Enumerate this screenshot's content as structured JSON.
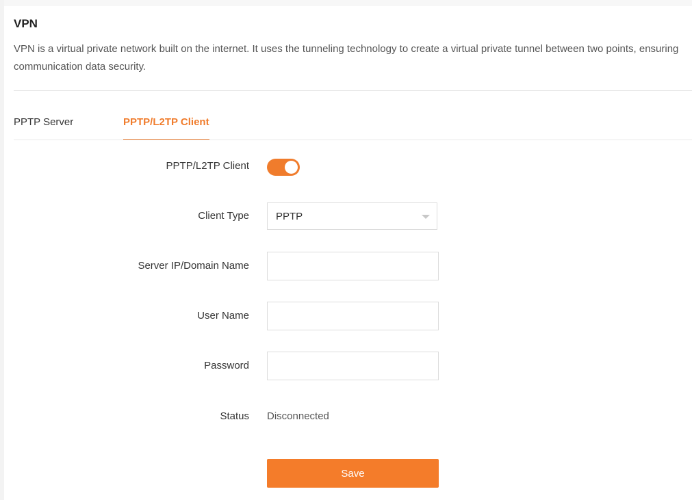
{
  "page": {
    "title": "VPN",
    "description": "VPN is a virtual private network built on the internet. It uses the tunneling technology to create a virtual private tunnel between two points, ensuring communication data security."
  },
  "tabs": [
    {
      "label": "PPTP Server",
      "active": false
    },
    {
      "label": "PPTP/L2TP Client",
      "active": true
    }
  ],
  "form": {
    "client_toggle": {
      "label": "PPTP/L2TP Client",
      "enabled": true
    },
    "client_type": {
      "label": "Client Type",
      "value": "PPTP"
    },
    "server": {
      "label": "Server IP/Domain Name",
      "value": ""
    },
    "username": {
      "label": "User Name",
      "value": ""
    },
    "password": {
      "label": "Password",
      "value": ""
    },
    "status": {
      "label": "Status",
      "value": "Disconnected"
    },
    "save_label": "Save"
  },
  "colors": {
    "accent": "#f07c2c",
    "button": "#f47c2a"
  }
}
